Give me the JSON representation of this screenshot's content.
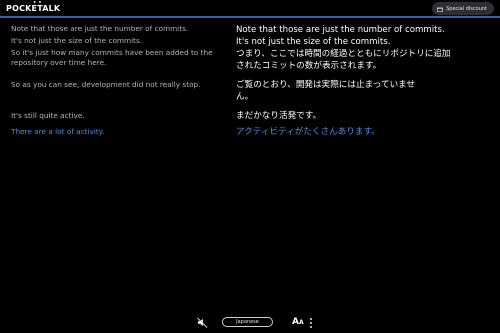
{
  "header": {
    "logo_text": "POCKETALK",
    "promo_label": "Special discount",
    "promo_icon": "gift-icon"
  },
  "transcript": {
    "source": [
      "Note that those are just the number of commits.",
      "It's not just the size of the commits.",
      "So it's just how many commits have been added to the repository over time here.",
      "So as you can see, development did not really stop.",
      "It's still quite active.",
      "There are a lot of activity."
    ],
    "translation": [
      "Note that those are just the number of commits.",
      "It's not just the size of the commits.",
      "つまり、ここでは時間の経過とともにリポジトリに追加されたコミットの数が表示されます。",
      "ご覧のとおり、開発は実際には止まっていません。",
      "まだかなり活発です。",
      "アクティビティがたくさんあります。"
    ],
    "active_index": 5,
    "colors": {
      "source_text": "#b4b4b4",
      "translation_text": "#ffffff",
      "active_text": "#4c8de0"
    }
  },
  "footer": {
    "mute_icon": "speaker-muted-icon",
    "language_label": "Japanese",
    "font_size_icon": "font-size-icon",
    "font_size_glyph_large": "A",
    "font_size_glyph_small": "A",
    "more_icon": "more-vertical-icon"
  },
  "theme": {
    "accent": "#2b63b6",
    "background": "#000000"
  }
}
